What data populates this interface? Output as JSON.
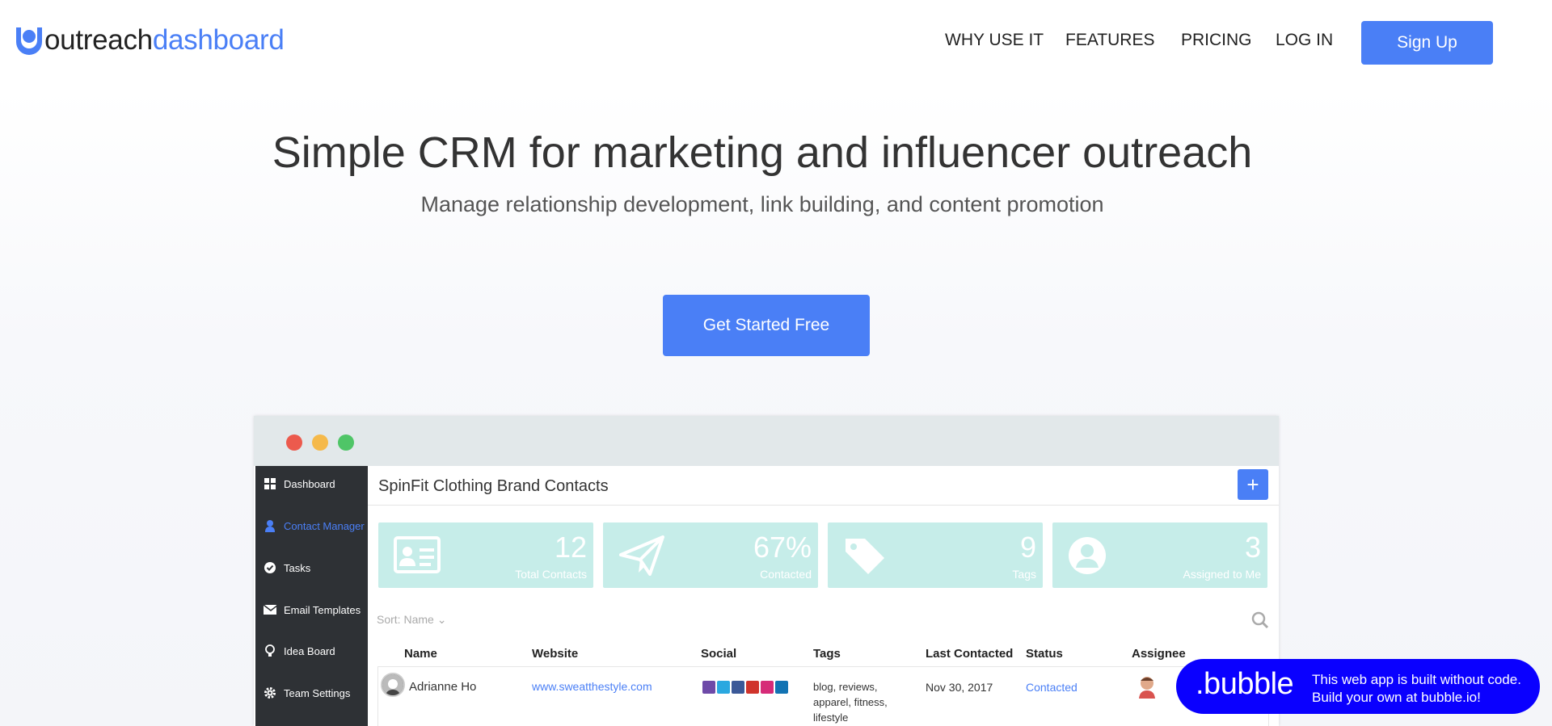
{
  "header": {
    "logo_part1": "outreach",
    "logo_part2": "dashboard",
    "nav": [
      "WHY USE IT",
      "FEATURES",
      "PRICING",
      "LOG IN"
    ],
    "signup_label": "Sign Up"
  },
  "hero": {
    "title": "Simple CRM for marketing and influencer outreach",
    "subtitle": "Manage relationship development, link building, and content promotion",
    "cta_label": "Get Started Free"
  },
  "mock": {
    "sidebar": [
      {
        "label": "Dashboard",
        "icon": "grid-icon"
      },
      {
        "label": "Contact Manager",
        "icon": "user-icon"
      },
      {
        "label": "Tasks",
        "icon": "check-circle-icon"
      },
      {
        "label": "Email Templates",
        "icon": "envelope-icon"
      },
      {
        "label": "Idea Board",
        "icon": "lightbulb-icon"
      },
      {
        "label": "Team Settings",
        "icon": "gear-icon"
      }
    ],
    "page_title": "SpinFit Clothing Brand Contacts",
    "add_label": "+",
    "stats": [
      {
        "value": "12",
        "label": "Total Contacts",
        "icon": "id-card-icon"
      },
      {
        "value": "67%",
        "label": "Contacted",
        "icon": "paper-plane-icon"
      },
      {
        "value": "9",
        "label": "Tags",
        "icon": "tag-icon"
      },
      {
        "value": "3",
        "label": "Assigned to Me",
        "icon": "user-circle-icon"
      }
    ],
    "sort_label": "Sort: Name ⌄",
    "columns": [
      "Name",
      "Website",
      "Social",
      "Tags",
      "Last Contacted",
      "Status",
      "Assignee"
    ],
    "rows": [
      {
        "name": "Adrianne Ho",
        "website": "www.sweatthestyle.com",
        "tags_line1": "blog, reviews,",
        "tags_line2": "apparel, fitness,",
        "tags_line3": "lifestyle",
        "last_contacted": "Nov 30, 2017",
        "status": "Contacted"
      }
    ],
    "colors": {
      "accent": "#4a7ff6",
      "stat_bg": "#c6ede9",
      "sidebar_bg": "#2e3135"
    }
  },
  "bubble": {
    "brand": ".bubble",
    "line1": "This web app is built without code.",
    "line2": "Build your own at bubble.io!"
  }
}
